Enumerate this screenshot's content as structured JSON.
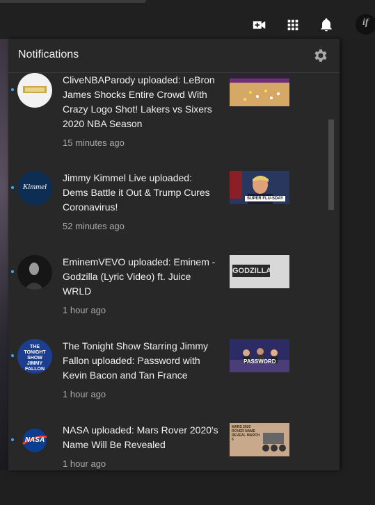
{
  "topbar": {
    "icons": [
      "create-video-icon",
      "apps-grid-icon",
      "bell-icon"
    ]
  },
  "panel": {
    "title": "Notifications",
    "settings_icon": "gear-icon"
  },
  "notifications": [
    {
      "text": "CliveNBAParody uploaded: LeBron James Shocks Entire Crowd With Crazy Logo Shot! Lakers vs Sixers 2020 NBA Season",
      "time": "15 minutes ago",
      "thumb_text": ""
    },
    {
      "text": "Jimmy Kimmel Live uploaded: Dems Battle it Out & Trump Cures Coronavirus!",
      "time": "52 minutes ago",
      "avatar_text": "Kimmel",
      "thumb_text": "SUPER FLU-SDAY"
    },
    {
      "text": "EminemVEVO uploaded: Eminem - Godzilla (Lyric Video) ft. Juice WRLD",
      "time": "1 hour ago",
      "thumb_text": "GODZILLA"
    },
    {
      "text": "The Tonight Show Starring Jimmy Fallon uploaded: Password with Kevin Bacon and Tan France",
      "time": "1 hour ago",
      "avatar_text": "THE TONIGHT SHOW JIMMY FALLON",
      "thumb_text": "PASSWORD"
    },
    {
      "text": "NASA uploaded: Mars Rover 2020's Name Will Be Revealed",
      "time": "1 hour ago",
      "avatar_text": "NASA",
      "thumb_text": "MARS 2020 ROVER NAME REVEAL MARCH 5"
    }
  ],
  "colors": {
    "unread_dot": "#3ea6ff",
    "panel_bg": "#282828",
    "text": "#f1f1f1",
    "muted": "#aaaaaa"
  }
}
